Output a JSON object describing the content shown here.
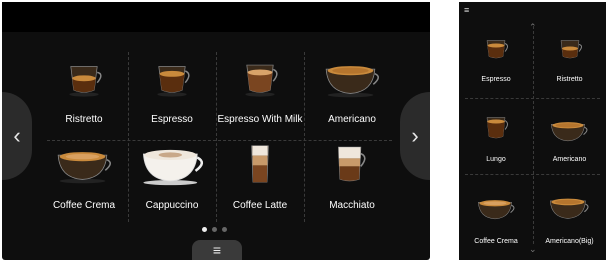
{
  "main": {
    "nav": {
      "prev_glyph": "‹",
      "next_glyph": "›"
    },
    "drinks": [
      {
        "label": "Ristretto",
        "icon": "ristretto-cup-icon"
      },
      {
        "label": "Espresso",
        "icon": "espresso-cup-icon"
      },
      {
        "label": "Espresso With Milk",
        "icon": "espresso-with-milk-cup-icon"
      },
      {
        "label": "Americano",
        "icon": "americano-cup-icon"
      },
      {
        "label": "Coffee Crema",
        "icon": "coffee-crema-cup-icon"
      },
      {
        "label": "Cappuccino",
        "icon": "cappuccino-cup-icon"
      },
      {
        "label": "Coffee Latte",
        "icon": "coffee-latte-glass-icon"
      },
      {
        "label": "Macchiato",
        "icon": "macchiato-glass-icon"
      }
    ],
    "pagination": {
      "pages": 3,
      "active": 1
    },
    "menu_glyph": "≡"
  },
  "side": {
    "menu_glyph": "≡",
    "scroll_up_glyph": "⌃",
    "scroll_down_glyph": "⌄",
    "drinks": [
      {
        "label": "Espresso",
        "icon": "espresso-cup-icon"
      },
      {
        "label": "Ristretto",
        "icon": "ristretto-cup-icon"
      },
      {
        "label": "Lungo",
        "icon": "lungo-cup-icon"
      },
      {
        "label": "Americano",
        "icon": "americano-cup-icon"
      },
      {
        "label": "Coffee Crema",
        "icon": "coffee-crema-cup-icon"
      },
      {
        "label": "Americano(Big)",
        "icon": "americano-big-cup-icon"
      }
    ]
  },
  "colors": {
    "screen_bg": "#0e0e0e",
    "coffee": "#5a2e0e",
    "crema": "#c98a3c",
    "milk_foam": "#efe7dc"
  }
}
